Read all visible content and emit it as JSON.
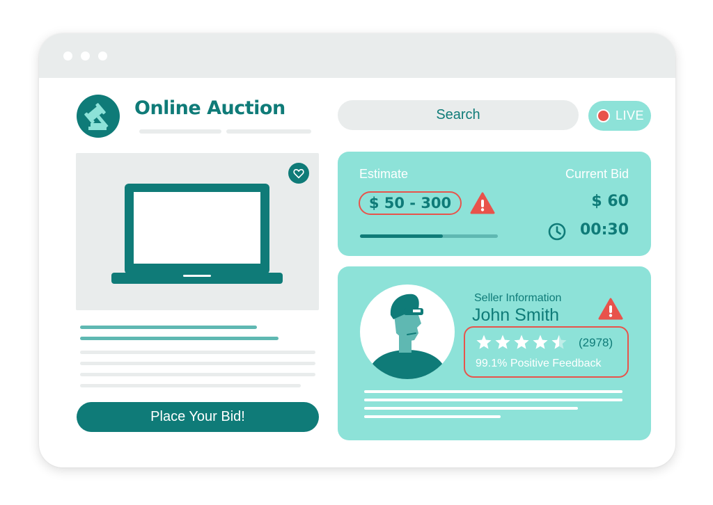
{
  "header": {
    "title": "Online Auction",
    "search_label": "Search",
    "live_label": "LIVE"
  },
  "product": {
    "icon": "laptop-icon",
    "favorite_icon": "heart-icon"
  },
  "actions": {
    "place_bid_label": "Place Your Bid!"
  },
  "auction": {
    "estimate_label": "Estimate",
    "estimate_value": "$ 50 - 300",
    "current_bid_label": "Current Bid",
    "current_bid_value": "$ 60",
    "timer_value": "00:30",
    "time_progress": 0.6
  },
  "seller": {
    "section_label": "Seller Information",
    "name": "John Smith",
    "rating": 4.5,
    "rating_max": 5,
    "review_count": "(2978)",
    "feedback": "99.1% Positive Feedback"
  },
  "colors": {
    "brand": "#0f7b78",
    "panel": "#8de2d8",
    "alert": "#e8534b",
    "neutral": "#e9ecec"
  }
}
